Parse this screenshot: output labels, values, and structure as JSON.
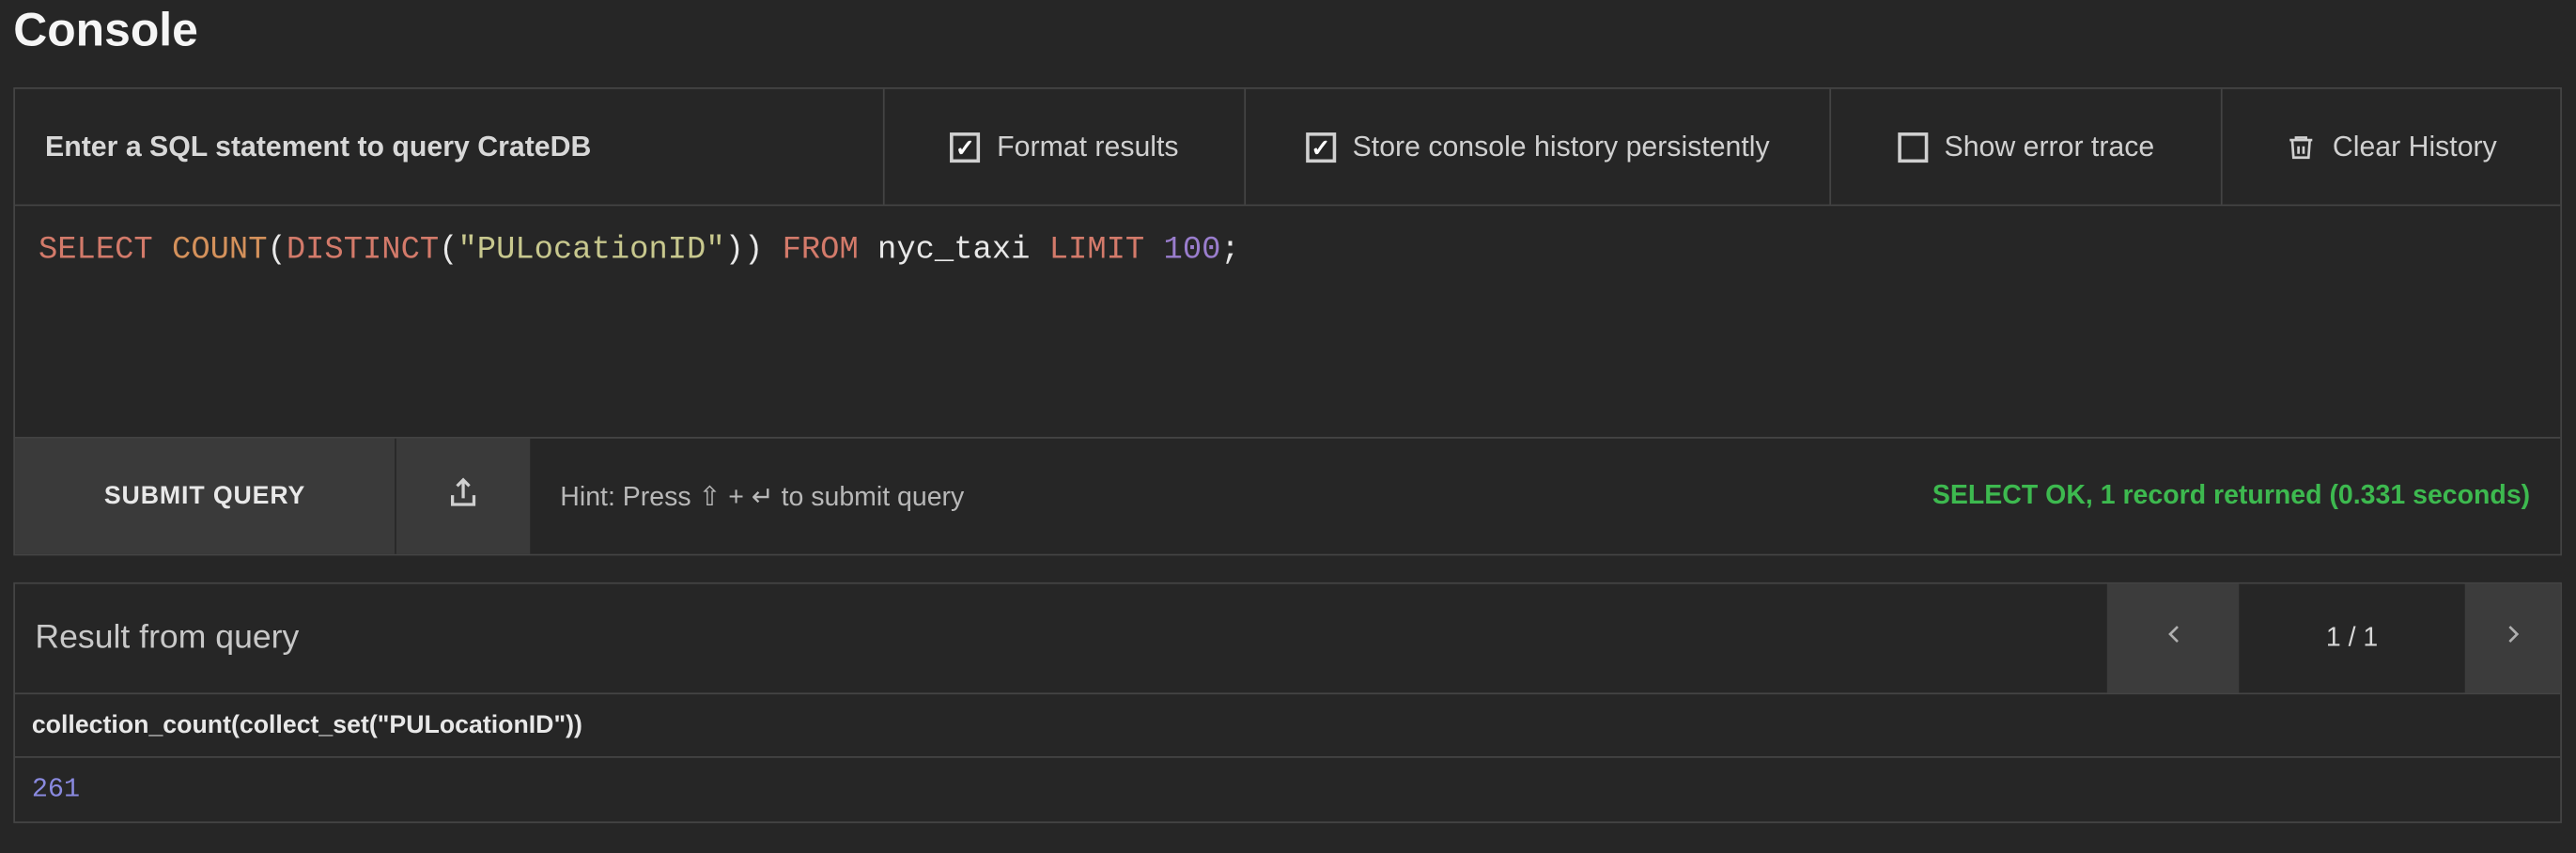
{
  "page_title": "Console",
  "toolbar": {
    "prompt": "Enter a SQL statement to query CrateDB",
    "format_label": "Format results",
    "format_checked": true,
    "persist_label": "Store console history persistently",
    "persist_checked": true,
    "trace_label": "Show error trace",
    "trace_checked": false,
    "clear_label": "Clear History"
  },
  "query": {
    "tokens": [
      {
        "t": "SELECT",
        "c": "kw"
      },
      {
        "t": " "
      },
      {
        "t": "COUNT",
        "c": "fn"
      },
      {
        "t": "("
      },
      {
        "t": "DISTINCT",
        "c": "kw"
      },
      {
        "t": "("
      },
      {
        "t": "\"PULocationID\"",
        "c": "str"
      },
      {
        "t": ")) "
      },
      {
        "t": "FROM",
        "c": "kw"
      },
      {
        "t": " nyc_taxi "
      },
      {
        "t": "LIMIT",
        "c": "kw"
      },
      {
        "t": " "
      },
      {
        "t": "100",
        "c": "num"
      },
      {
        "t": ";"
      }
    ],
    "raw": "SELECT COUNT(DISTINCT(\"PULocationID\")) FROM nyc_taxi LIMIT 100;"
  },
  "actions": {
    "submit_label": "SUBMIT QUERY",
    "hint": "Hint: Press ⇧ + ↵ to submit query",
    "status": "SELECT OK, 1 record returned (0.331 seconds)"
  },
  "results": {
    "title": "Result from query",
    "page_indicator": "1 / 1",
    "columns": [
      "collection_count(collect_set(\"PULocationID\"))"
    ],
    "rows": [
      [
        "261"
      ]
    ]
  }
}
